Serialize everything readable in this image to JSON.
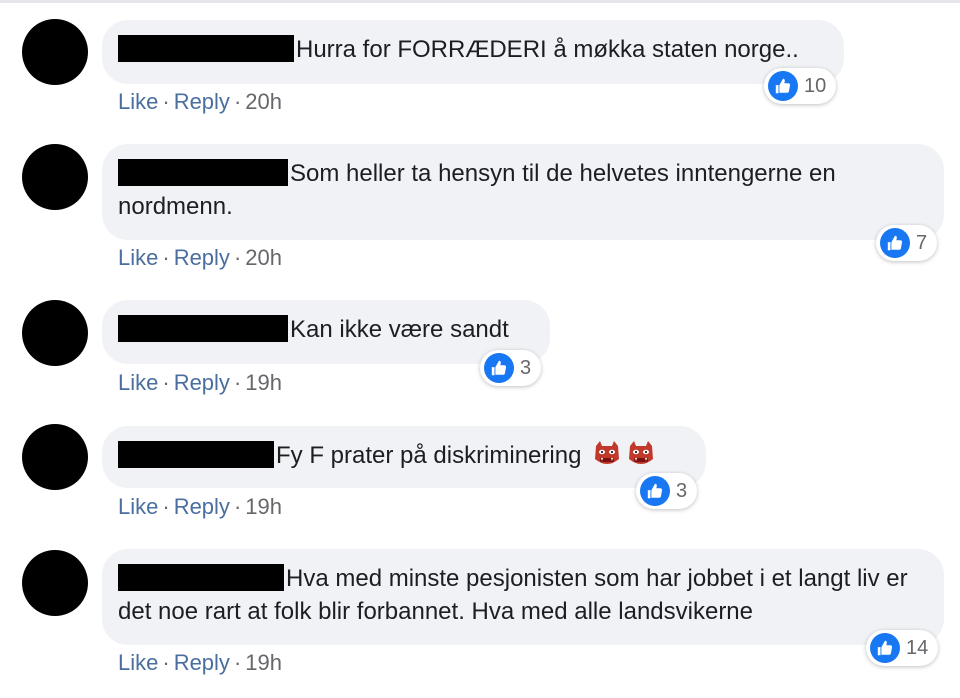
{
  "comments": [
    {
      "text": "Hurra for FORRÆDERI å møkka staten norge..",
      "reactions": "10",
      "actions": {
        "like": "Like",
        "reply": "Reply"
      },
      "time": "20h"
    },
    {
      "text": "Som heller ta hensyn til de helvetes inntengerne en nordmenn.",
      "reactions": "7",
      "actions": {
        "like": "Like",
        "reply": "Reply"
      },
      "time": "20h"
    },
    {
      "text": "Kan ikke være sandt",
      "reactions": "3",
      "actions": {
        "like": "Like",
        "reply": "Reply"
      },
      "time": "19h"
    },
    {
      "text": "Fy F prater på diskriminering",
      "emojis": [
        "ogre-mask-icon",
        "ogre-mask-icon"
      ],
      "reactions": "3",
      "actions": {
        "like": "Like",
        "reply": "Reply"
      },
      "time": "19h"
    },
    {
      "text": "Hva med minste pesjonisten som har jobbet i et langt liv er det noe rart at folk blir forbannet. Hva med alle landsvikerne",
      "reactions": "14",
      "actions": {
        "like": "Like",
        "reply": "Reply"
      },
      "time": "19h"
    }
  ],
  "separator": "·",
  "colors": {
    "bubble": "#f0f2f5",
    "like_blue": "#1877f2",
    "action_link": "#4a6ea0",
    "meta_gray": "#65676b"
  }
}
